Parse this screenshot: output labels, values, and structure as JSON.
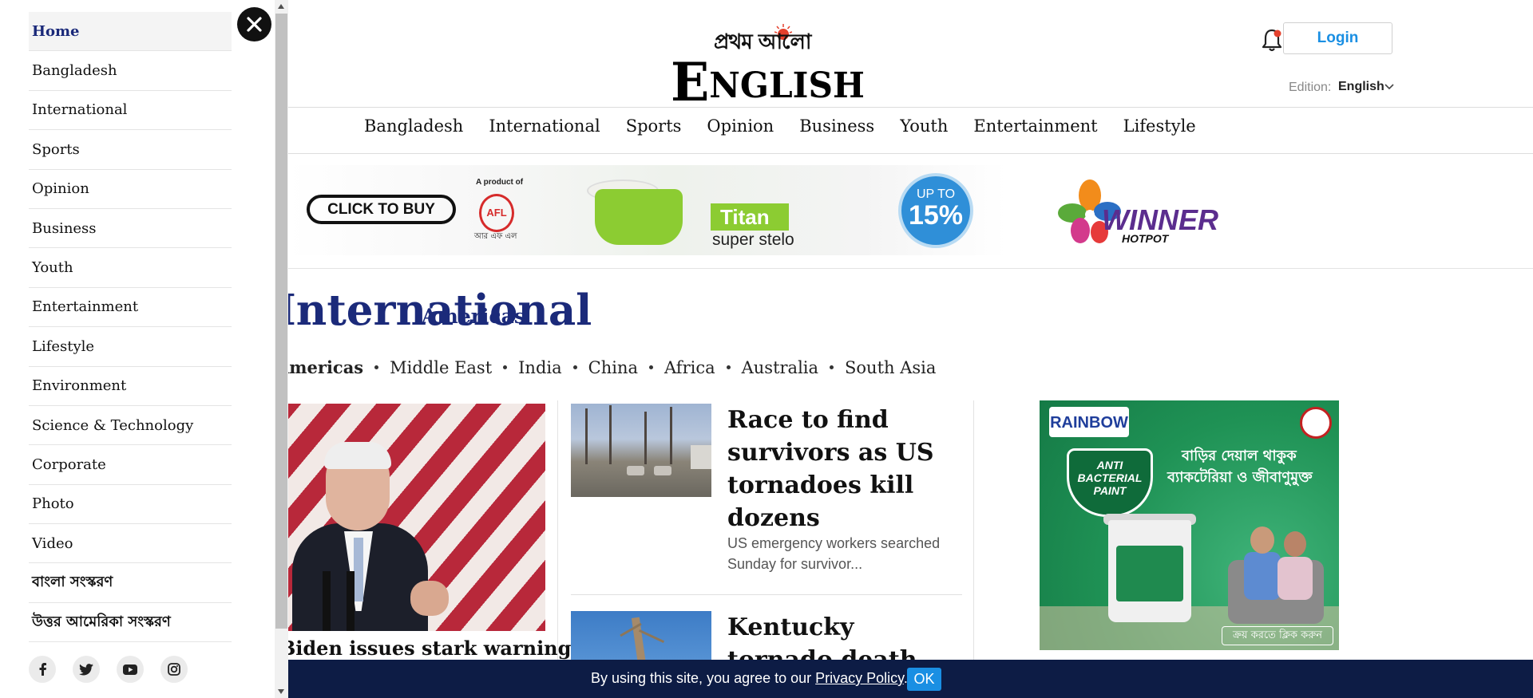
{
  "header": {
    "logo_bangla": "প্রথম আলো",
    "logo_word": "ENGLISH",
    "login_label": "Login",
    "edition_label": "Edition:",
    "edition_value": "English"
  },
  "topnav": [
    "Bangladesh",
    "International",
    "Sports",
    "Opinion",
    "Business",
    "Youth",
    "Entertainment",
    "Lifestyle"
  ],
  "banner": {
    "cta": "CLICK TO BUY",
    "product_of": "A product of",
    "brand_logo": "AFL",
    "brand_bangla": "আর এফ এল",
    "product_name": "Titan",
    "product_tagline": "super stelo",
    "discount_top": "UP TO",
    "discount_value": "15%",
    "sponsor": "WINNER",
    "sponsor_sub": "HOTPOT"
  },
  "section": {
    "title": "International",
    "subtitle": "Americas",
    "subnav": [
      {
        "label": "Americas",
        "active": true
      },
      {
        "label": "Middle East",
        "active": false
      },
      {
        "label": "India",
        "active": false
      },
      {
        "label": "China",
        "active": false
      },
      {
        "label": "Africa",
        "active": false
      },
      {
        "label": "Australia",
        "active": false
      },
      {
        "label": "South Asia",
        "active": false
      }
    ]
  },
  "lead": {
    "headline": "Biden issues stark warning over"
  },
  "stories": [
    {
      "title": "Race to find survivors as US tornadoes kill dozens",
      "summary": "US emergency workers searched Sunday for survivor..."
    },
    {
      "title": "Kentucky tornado death toll rises to",
      "summary": ""
    }
  ],
  "ad": {
    "brand": "RAINBOW",
    "product": "ANTI BACTERIAL PAINT",
    "line1": "বাড়ির দেয়াল থাকুক",
    "line2": "ব্যাকটেরিয়া ও জীবাণুমুক্ত",
    "cta": "ক্রয় করতে ক্লিক করুন"
  },
  "consent": {
    "text_before": "By using this site, you agree to our ",
    "link": "Privacy Policy",
    "text_after": ".",
    "ok_label": "OK"
  },
  "drawer": {
    "items": [
      {
        "label": "Home",
        "active": true
      },
      {
        "label": "Bangladesh"
      },
      {
        "label": "International"
      },
      {
        "label": "Sports"
      },
      {
        "label": "Opinion"
      },
      {
        "label": "Business"
      },
      {
        "label": "Youth"
      },
      {
        "label": "Entertainment"
      },
      {
        "label": "Lifestyle"
      },
      {
        "label": "Environment"
      },
      {
        "label": "Science & Technology"
      },
      {
        "label": "Corporate"
      },
      {
        "label": "Photo"
      },
      {
        "label": "Video"
      },
      {
        "label": "বাংলা সংস্করণ"
      },
      {
        "label": "উত্তর আমেরিকা সংস্করণ"
      }
    ],
    "social": [
      "facebook-icon",
      "twitter-icon",
      "youtube-icon",
      "instagram-icon"
    ]
  },
  "colors": {
    "brand_blue": "#1b2a7a",
    "login_blue": "#1a8fe3",
    "consent_bg": "#0d1c45",
    "notification_dot": "#e4412d"
  }
}
